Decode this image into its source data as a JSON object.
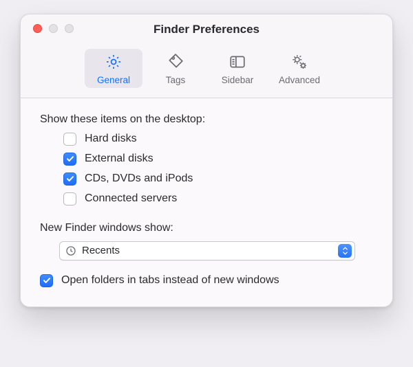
{
  "window": {
    "title": "Finder Preferences"
  },
  "toolbar": {
    "general": "General",
    "tags": "Tags",
    "sidebar": "Sidebar",
    "advanced": "Advanced",
    "active": "general"
  },
  "desktop_section": {
    "title": "Show these items on the desktop:",
    "items": [
      {
        "label": "Hard disks",
        "checked": false
      },
      {
        "label": "External disks",
        "checked": true
      },
      {
        "label": "CDs, DVDs and iPods",
        "checked": true
      },
      {
        "label": "Connected servers",
        "checked": false
      }
    ]
  },
  "new_window_section": {
    "title": "New Finder windows show:",
    "value": "Recents"
  },
  "open_in_tabs": {
    "label": "Open folders in tabs instead of new windows",
    "checked": true
  }
}
